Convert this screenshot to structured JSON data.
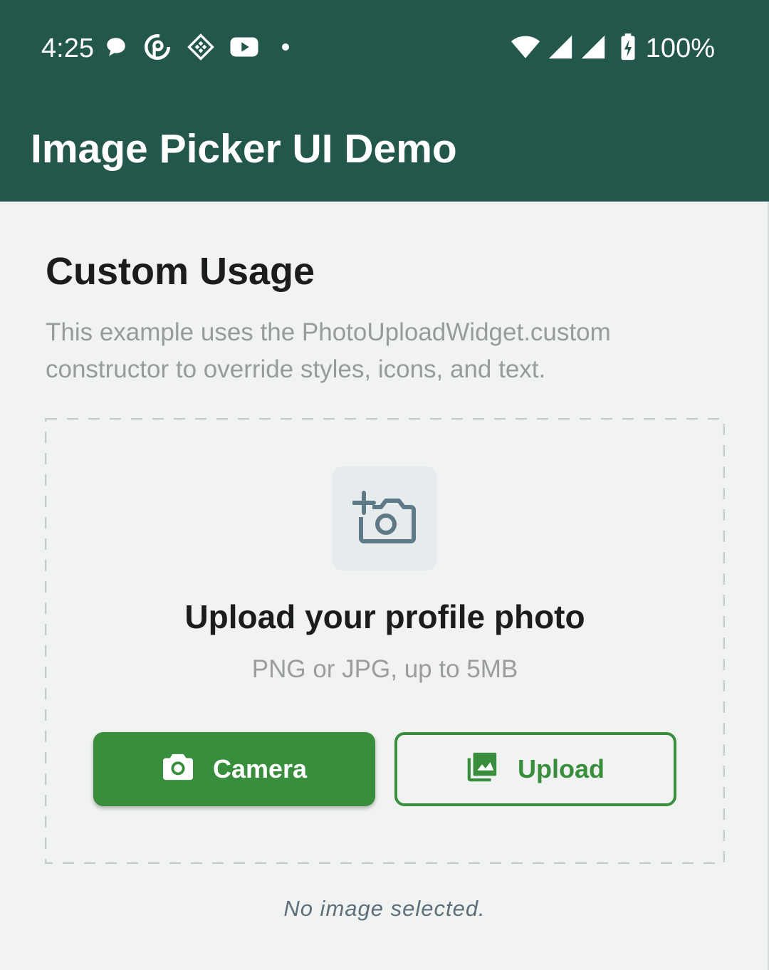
{
  "status_bar": {
    "time": "4:25",
    "battery": "100%",
    "left_icons": [
      "chat-bubble-icon",
      "podcast-icon",
      "diamond-grid-icon",
      "youtube-icon",
      "dot-icon"
    ],
    "right_icons": [
      "wifi-icon",
      "signal-icon",
      "signal-icon",
      "battery-charging-icon"
    ]
  },
  "app_bar": {
    "title": "Image Picker UI Demo"
  },
  "section": {
    "title": "Custom Usage",
    "description": "This example uses the PhotoUploadWidget.custom constructor to override styles, icons, and text."
  },
  "upload_widget": {
    "icon": "add-a-photo-icon",
    "title": "Upload your profile photo",
    "subtitle": "PNG or JPG, up to 5MB",
    "camera_button": {
      "label": "Camera",
      "icon": "camera-icon"
    },
    "upload_button": {
      "label": "Upload",
      "icon": "photo-library-icon"
    }
  },
  "status_message": "No image selected.",
  "colors": {
    "app_bar": "#23574b",
    "background": "#f0f3f2",
    "accent": "#388e3c",
    "icon_tile": "#e6ebed",
    "icon": "#5f7a87"
  }
}
